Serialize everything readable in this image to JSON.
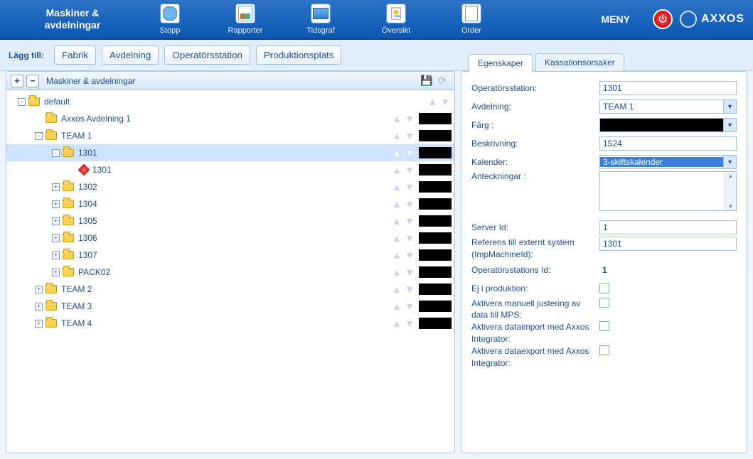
{
  "header": {
    "title_line1": "Maskiner &",
    "title_line2": "avdelningar",
    "nav": [
      {
        "label": "Stopp",
        "icon": "stop-icon"
      },
      {
        "label": "Rapporter",
        "icon": "report-icon"
      },
      {
        "label": "Tidsgraf",
        "icon": "timegraph-icon"
      },
      {
        "label": "Översikt",
        "icon": "overview-icon"
      },
      {
        "label": "Order",
        "icon": "order-icon"
      }
    ],
    "menu_label": "MENY",
    "brand": "AXXOS"
  },
  "toolbar": {
    "label": "Lägg till:",
    "buttons": [
      "Fabrik",
      "Avdelning",
      "Operatörsstation",
      "Produktionsplats"
    ]
  },
  "tree_header": {
    "title": "Maskiner & avdelningar"
  },
  "tree": [
    {
      "depth": 0,
      "exp": "-",
      "icon": "folder",
      "label": "default",
      "ctrl": true
    },
    {
      "depth": 1,
      "exp": "",
      "icon": "folder",
      "label": "Axxos Avdelning 1",
      "ctrl": true
    },
    {
      "depth": 1,
      "exp": "-",
      "icon": "folder",
      "label": "TEAM 1",
      "ctrl": true
    },
    {
      "depth": 2,
      "exp": "-",
      "icon": "folder",
      "label": "1301",
      "ctrl": true,
      "selected": true
    },
    {
      "depth": 3,
      "exp": "",
      "icon": "red",
      "label": "1301",
      "ctrl": true
    },
    {
      "depth": 2,
      "exp": "+",
      "icon": "folder",
      "label": "1302",
      "ctrl": true
    },
    {
      "depth": 2,
      "exp": "+",
      "icon": "folder",
      "label": "1304",
      "ctrl": true
    },
    {
      "depth": 2,
      "exp": "+",
      "icon": "folder",
      "label": "1305",
      "ctrl": true
    },
    {
      "depth": 2,
      "exp": "+",
      "icon": "folder",
      "label": "1306",
      "ctrl": true
    },
    {
      "depth": 2,
      "exp": "+",
      "icon": "folder",
      "label": "1307",
      "ctrl": true
    },
    {
      "depth": 2,
      "exp": "+",
      "icon": "folder",
      "label": "PACK02",
      "ctrl": true
    },
    {
      "depth": 1,
      "exp": "+",
      "icon": "folder",
      "label": "TEAM 2",
      "ctrl": true
    },
    {
      "depth": 1,
      "exp": "+",
      "icon": "folder",
      "label": "TEAM 3",
      "ctrl": true
    },
    {
      "depth": 1,
      "exp": "+",
      "icon": "folder",
      "label": "TEAM 4",
      "ctrl": true
    }
  ],
  "right": {
    "tabs": [
      "Egenskaper",
      "Kassationsorsaker"
    ],
    "active_tab": 0,
    "fields": {
      "operatorsstation_lbl": "Operatörsstation:",
      "operatorsstation_val": "1301",
      "avdelning_lbl": "Avdelning:",
      "avdelning_val": "TEAM 1",
      "farg_lbl": "Färg :",
      "farg_val": "#000000",
      "beskrivning_lbl": "Beskrivning:",
      "beskrivning_val": "1524",
      "kalender_lbl": "Kalender:",
      "kalender_val": "3-skiftskalender",
      "anteckningar_lbl": "Anteckningar :",
      "anteckningar_val": "",
      "serverid_lbl": "Server Id:",
      "serverid_val": "1",
      "referens_lbl": "Referens till externt system (ImpMachineId):",
      "referens_val": "1301",
      "opstationid_lbl": "Operatörsstations Id:",
      "opstationid_val": "1",
      "ejiprod_lbl": "Ej i produktion:",
      "aktmanuell_lbl": "Aktivera manuell justering av data till MPS:",
      "aktimport_lbl": "Aktivera dataimport med Axxos Integrator:",
      "aktexport_lbl": "Aktivera dataexport med Axxos Integrator:"
    }
  }
}
